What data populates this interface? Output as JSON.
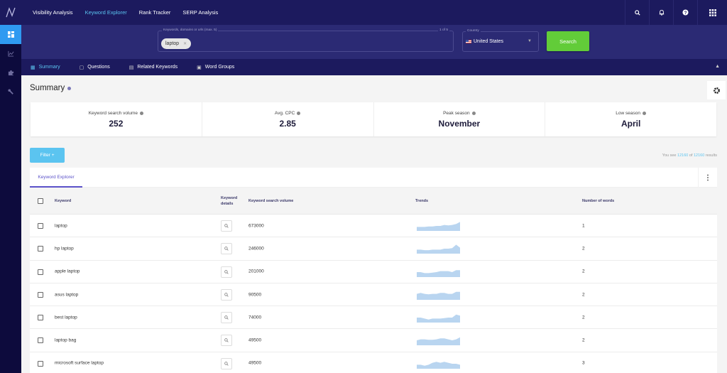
{
  "topnav": {
    "items": [
      {
        "label": "Visibility Analysis",
        "active": false
      },
      {
        "label": "Keyword Explorer",
        "active": true
      },
      {
        "label": "Rank Tracker",
        "active": false
      },
      {
        "label": "SERP Analysis",
        "active": false
      }
    ],
    "icons": [
      "search-icon",
      "bell-icon",
      "help-icon",
      "apps-grid-icon"
    ]
  },
  "sidebar": {
    "items": [
      {
        "icon": "dashboard-icon",
        "active": true
      },
      {
        "icon": "chart-icon",
        "active": false
      },
      {
        "icon": "puzzle-icon",
        "active": false
      },
      {
        "icon": "wrench-icon",
        "active": false
      }
    ]
  },
  "search": {
    "keywords_label": "Keywords, domains or urls (max. 5)",
    "count": "1 of 5",
    "chip": "laptop",
    "country_label": "Country",
    "country_value": "United States",
    "button": "Search"
  },
  "subtabs": [
    {
      "label": "Summary",
      "icon": "dashboard-icon",
      "active": true
    },
    {
      "label": "Questions",
      "icon": "question-icon",
      "active": false
    },
    {
      "label": "Related Keywords",
      "icon": "document-icon",
      "active": false
    },
    {
      "label": "Word Groups",
      "icon": "group-icon",
      "active": false
    }
  ],
  "summary": {
    "title": "Summary",
    "stats": [
      {
        "label": "Keyword search volume",
        "value": "252"
      },
      {
        "label": "Avg. CPC",
        "value": "2.85"
      },
      {
        "label": "Peak season",
        "value": "November"
      },
      {
        "label": "Low season",
        "value": "April"
      }
    ]
  },
  "filter": {
    "label": "Filter +"
  },
  "results": {
    "prefix": "You see",
    "shown": "12160",
    "of": "of",
    "total": "12160",
    "suffix": "results"
  },
  "table": {
    "tab": "Keyword Explorer",
    "headers": {
      "keyword": "Keyword",
      "details": "Keyword details",
      "volume": "Keyword search volume",
      "trends": "Trends",
      "words": "Number of words"
    },
    "rows": [
      {
        "keyword": "laptop",
        "volume": "673000",
        "words": "1",
        "trend": [
          4,
          4,
          4,
          4.5,
          4.5,
          5,
          5,
          6,
          5.5,
          6,
          7,
          9
        ]
      },
      {
        "keyword": "hp laptop",
        "volume": "246000",
        "words": "2",
        "trend": [
          4,
          4,
          3.5,
          3.5,
          4,
          4,
          4,
          5,
          5,
          5.5,
          9,
          6
        ]
      },
      {
        "keyword": "apple laptop",
        "volume": "201000",
        "words": "2",
        "trend": [
          5,
          5,
          4,
          4,
          4.5,
          5,
          6,
          6,
          6,
          5,
          7,
          7
        ]
      },
      {
        "keyword": "asus laptop",
        "volume": "90500",
        "words": "2",
        "trend": [
          6,
          7,
          6,
          5.5,
          6,
          6,
          7,
          7,
          6,
          6,
          8,
          8
        ]
      },
      {
        "keyword": "best laptop",
        "volume": "74000",
        "words": "2",
        "trend": [
          5,
          5,
          4,
          3,
          4,
          4,
          4,
          4.5,
          5,
          5,
          8,
          7
        ]
      },
      {
        "keyword": "laptop bag",
        "volume": "49500",
        "words": "2",
        "trend": [
          5,
          6,
          6,
          5.5,
          5.5,
          6,
          7,
          7,
          6,
          5,
          6,
          8
        ]
      },
      {
        "keyword": "microsoft surface laptop",
        "volume": "49500",
        "words": "3",
        "trend": [
          4,
          4,
          3,
          4,
          6,
          7,
          6,
          7,
          6,
          5,
          5,
          4
        ]
      }
    ]
  },
  "colors": {
    "nav_bg": "#1c1a5e",
    "search_bg": "#2b2a74",
    "accent_blue": "#5bc4f0",
    "search_green": "#62cc39",
    "tab_purple": "#5b52c9",
    "sparkline": "#b9d5f0"
  }
}
